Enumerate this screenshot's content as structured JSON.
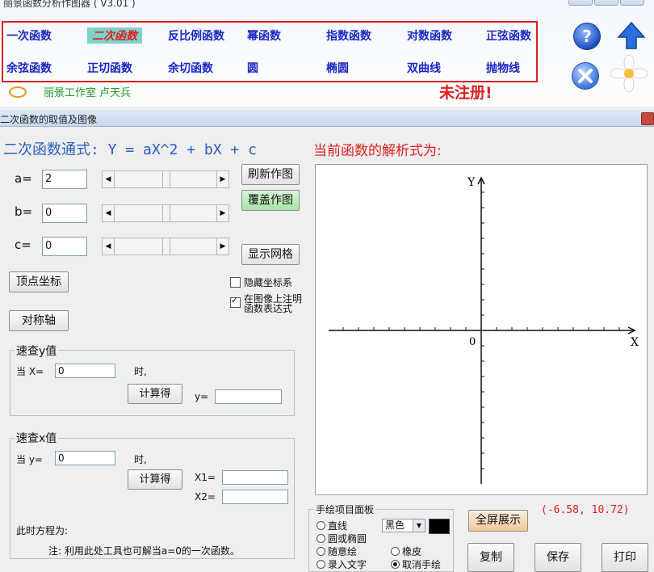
{
  "app": {
    "title": "丽景函数分析作图器 ( V3.01 )",
    "studio": "丽景工作室    卢天兵",
    "unregistered": "未注册!"
  },
  "function_menu": {
    "row1": [
      "一次函数",
      "二次函数",
      "反比例函数",
      "幂函数",
      "指数函数",
      "对数函数",
      "正弦函数"
    ],
    "row2": [
      "余弦函数",
      "正切函数",
      "余切函数",
      "圆",
      "椭圆",
      "双曲线",
      "抛物线"
    ],
    "active": "二次函数"
  },
  "icons": {
    "help": "help-icon",
    "up": "up-arrow-icon",
    "close": "close-icon"
  },
  "dialog": {
    "title": "二次函数的取值及图像",
    "formula_title": "二次函数通式: Y = aX^2 + bX + c",
    "current_formula_label": "当前函数的解析式为:"
  },
  "params": {
    "a_label": "a=",
    "a_value": "2",
    "b_label": "b=",
    "b_value": "0",
    "c_label": "c=",
    "c_value": "0"
  },
  "buttons": {
    "refresh": "刷新作图",
    "overlay": "覆盖作图",
    "show_grid": "显示网格",
    "vertex": "顶点坐标",
    "axis": "对称轴",
    "calc_y": "计算得",
    "calc_x": "计算得",
    "fullscreen": "全屏展示",
    "copy": "复制",
    "save": "保存",
    "print": "打印"
  },
  "options": {
    "hide_axes": "隐藏坐标系",
    "hide_axes_checked": false,
    "show_expr_line1": "在图像上注明",
    "show_expr_line2": "函数表达式",
    "show_expr_checked": true
  },
  "quick_y": {
    "title": "速查y值",
    "when_label": "当 X=",
    "x_value": "0",
    "time_label": "时,",
    "y_label": "y=",
    "y_value": ""
  },
  "quick_x": {
    "title": "速查x值",
    "when_label": "当 y=",
    "y_value": "0",
    "time_label": "时,",
    "x1_label": "X1=",
    "x1_value": "",
    "x2_label": "X2=",
    "x2_value": "",
    "equation_label": "此时方程为:",
    "note": "注: 利用此处工具也可解当a=0的一次函数。"
  },
  "graph": {
    "x_label": "X",
    "y_label": "Y",
    "origin_label": "0",
    "coordinates": "(-6.58, 10.72)"
  },
  "draw_panel": {
    "title": "手绘项目面板",
    "line": "直线",
    "circle": "圆或椭圆",
    "free": "随意绘",
    "text": "录入文字",
    "eraser": "橡皮",
    "cancel": "取消手绘",
    "color": "黑色",
    "color_hex": "#000000"
  }
}
